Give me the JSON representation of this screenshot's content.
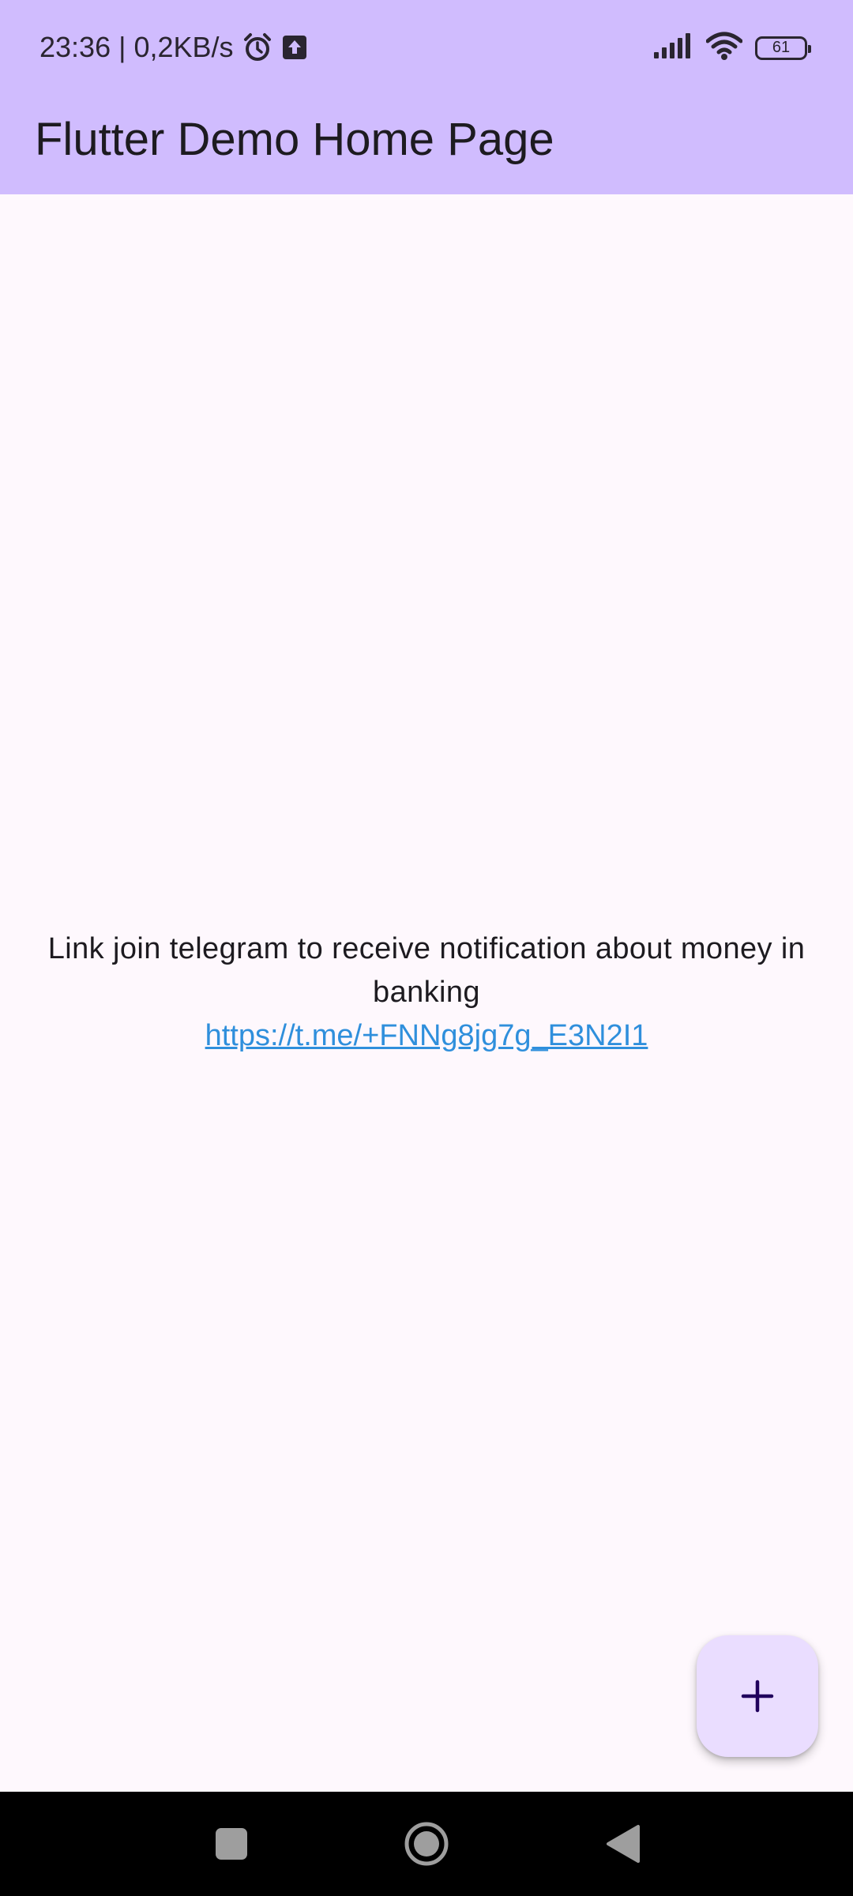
{
  "status_bar": {
    "time_speed": "23:36 | 0,2KB/s",
    "icons": [
      "alarm-icon",
      "upload-icon",
      "signal-icon",
      "wifi-icon",
      "battery-icon"
    ],
    "battery_level": "61"
  },
  "app_bar": {
    "title": "Flutter Demo Home Page"
  },
  "main": {
    "message": "Link join telegram to receive notification about money in banking",
    "link": "https://t.me/+FNNg8jg7g_E3N2I1"
  },
  "fab": {
    "icon": "plus-icon"
  },
  "nav_bar": {
    "icons": [
      "recent-apps-icon",
      "home-icon",
      "back-icon"
    ]
  },
  "colors": {
    "app_bar": "#d0bcfe",
    "background": "#fef8fd",
    "fab": "#eaddff",
    "link": "#2f8fdc"
  }
}
